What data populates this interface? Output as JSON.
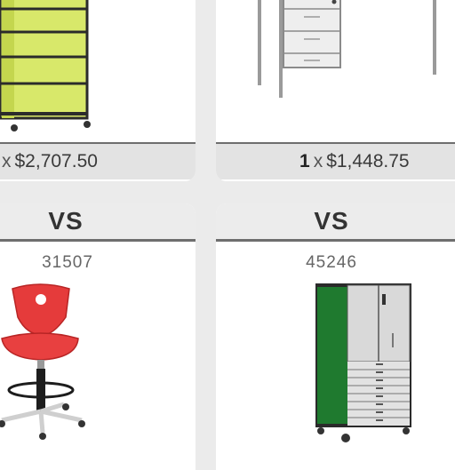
{
  "cards": [
    {
      "quantity": "",
      "times": "x",
      "price": "$2,707.50"
    },
    {
      "quantity": "1",
      "times": "x",
      "price": "$1,448.75"
    },
    {
      "vs_label": "VS",
      "product_code": "31507",
      "product_image": "red-task-stool-icon"
    },
    {
      "vs_label": "VS",
      "product_code": "45246",
      "product_image": "green-storage-cabinet-icon"
    }
  ],
  "top_images": [
    "yellow-shelving-unit-icon",
    "white-desk-icon"
  ],
  "colors": {
    "background": "#ebebeb",
    "card": "#ffffff",
    "bar": "#e3e3e3",
    "divider": "#6e6e6e"
  }
}
